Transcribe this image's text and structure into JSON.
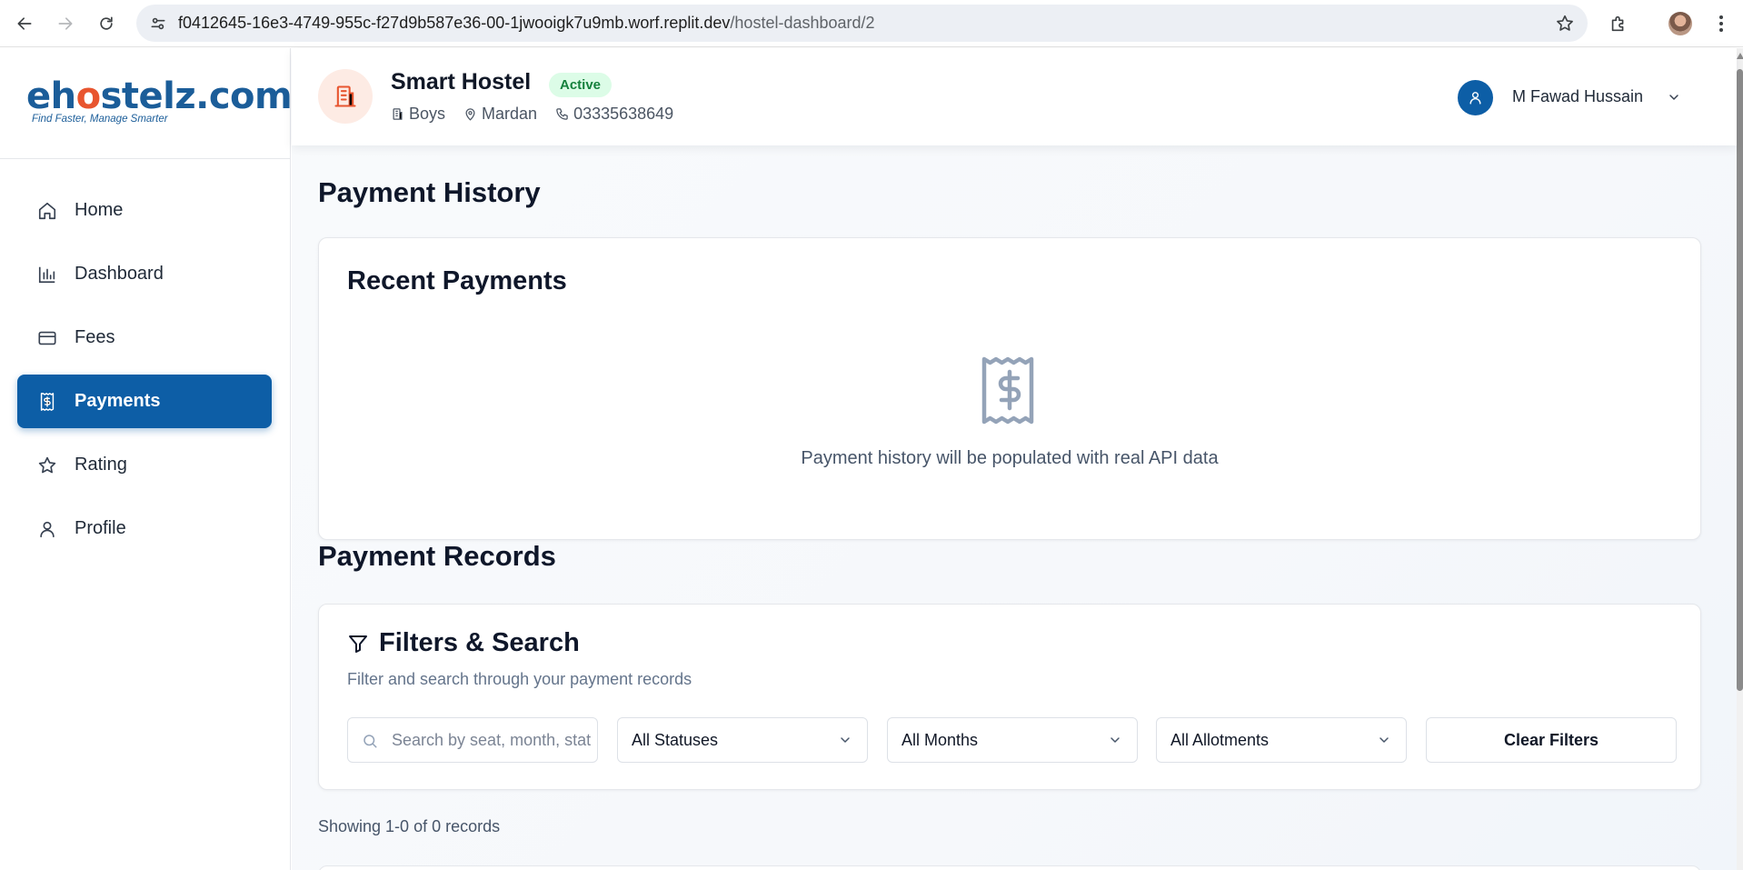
{
  "browser": {
    "url_host": "f0412645-16e3-4749-955c-f27d9b587e36-00-1jwooigk7u9mb.worf.replit.dev",
    "url_path": "/hostel-dashboard/2"
  },
  "brand": {
    "logo_text_a": "eh",
    "logo_text_b": "o",
    "logo_text_c": "stelz.com",
    "tagline": "Find Faster, Manage Smarter",
    "colors": {
      "primary": "#0d5ea6",
      "accent": "#e8552f"
    }
  },
  "sidebar": {
    "items": [
      {
        "label": "Home",
        "icon": "home-icon"
      },
      {
        "label": "Dashboard",
        "icon": "bar-chart-icon"
      },
      {
        "label": "Fees",
        "icon": "credit-card-icon"
      },
      {
        "label": "Payments",
        "icon": "receipt-icon",
        "active": true
      },
      {
        "label": "Rating",
        "icon": "star-icon"
      },
      {
        "label": "Profile",
        "icon": "user-icon"
      }
    ]
  },
  "header": {
    "hostel_name": "Smart Hostel",
    "status": "Active",
    "type": "Boys",
    "city": "Mardan",
    "phone": "03335638649",
    "user_name": "M Fawad Hussain"
  },
  "main": {
    "page_title": "Payment History",
    "recent": {
      "title": "Recent Payments",
      "empty_message": "Payment history will be populated with real API data"
    },
    "records": {
      "title": "Payment Records",
      "filters_title": "Filters & Search",
      "filters_desc": "Filter and search through your payment records",
      "search_placeholder": "Search by seat, month, status...",
      "search_value": "",
      "status_select": "All Statuses",
      "months_select": "All Months",
      "allotments_select": "All Allotments",
      "clear_label": "Clear Filters",
      "showing": "Showing 1-0 of 0 records"
    }
  }
}
